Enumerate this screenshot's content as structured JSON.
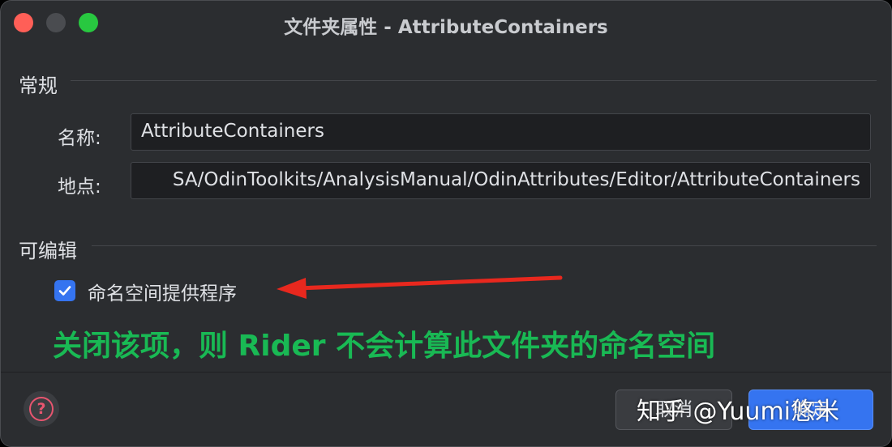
{
  "window": {
    "title": "文件夹属性 - AttributeContainers"
  },
  "general": {
    "section_label": "常规",
    "name_label": "名称:",
    "name_value": "AttributeContainers",
    "location_label": "地点:",
    "location_value": "SA/OdinToolkits/AnalysisManual/OdinAttributes/Editor/AttributeContainers"
  },
  "editable": {
    "section_label": "可编辑",
    "namespace_provider_label": "命名空间提供程序",
    "namespace_provider_checked": true
  },
  "annotation": {
    "text": "关闭该项，则 Rider 不会计算此文件夹的命名空间",
    "color": "#19b954",
    "arrow_color": "#e8281e"
  },
  "footer": {
    "cancel_label": "取消",
    "ok_label": "确定"
  },
  "watermark": {
    "text": "知乎 @Yuumi悠米"
  },
  "colors": {
    "background": "#2b2d30",
    "accent": "#3574f0",
    "close": "#ff5f57",
    "maximize": "#28c840",
    "help": "#e8556f"
  },
  "icons": [
    "close-traffic-light",
    "minimize-traffic-light",
    "maximize-traffic-light",
    "checkmark-icon",
    "help-icon",
    "arrow-icon"
  ]
}
